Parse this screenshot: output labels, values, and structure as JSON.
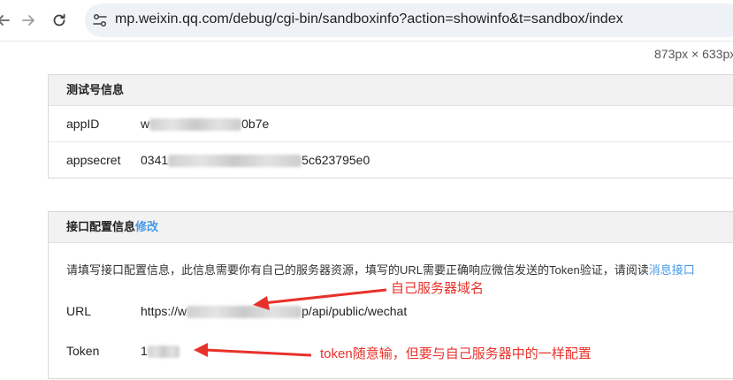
{
  "browser": {
    "url": "mp.weixin.qq.com/debug/cgi-bin/sandboxinfo?action=showinfo&t=sandbox/index",
    "viewport_size": "873px × 633px"
  },
  "test_account": {
    "title": "测试号信息",
    "rows": [
      {
        "label": "appID",
        "value_prefix": "w",
        "value_suffix": "0b7e"
      },
      {
        "label": "appsecret",
        "value_prefix": "0341",
        "value_suffix": "5c623795e0"
      }
    ]
  },
  "interface_config": {
    "title": "接口配置信息",
    "edit_label": "修改",
    "notice": "请填写接口配置信息，此信息需要你有自己的服务器资源，填写的URL需要正确响应微信发送的Token验证，请阅读",
    "notice_link": "消息接口",
    "url_label": "URL",
    "url_value_prefix": "https://w",
    "url_value_suffix": "p/api/public/wechat",
    "token_label": "Token",
    "token_value_prefix": "1"
  },
  "annotations": {
    "domain_note": "自己服务器域名",
    "token_note": "token随意输，但要与自己服务器中的一样配置"
  },
  "colors": {
    "annotation": "#e8312b",
    "link": "#459ae9"
  }
}
